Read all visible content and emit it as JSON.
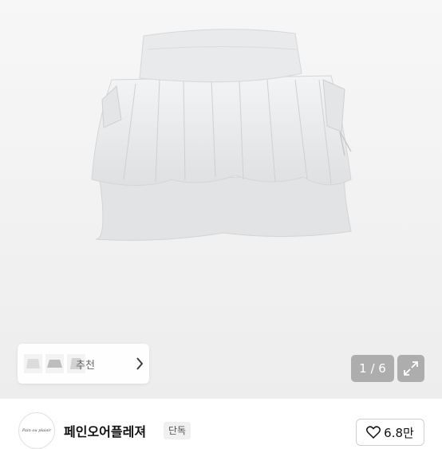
{
  "gallery": {
    "counter_text": "1 / 6",
    "similar_label": "추천"
  },
  "shop": {
    "logo_text": "Pain ou plaisir",
    "brand_name": "페인오어플레져",
    "badge": "단독"
  },
  "like": {
    "count": "6.8만"
  },
  "colors": {
    "background": "#efefef",
    "overlay": "#787878",
    "text_dark": "#111111"
  },
  "icons": {
    "expand": "expand-icon",
    "chevron": "chevron-right-icon",
    "heart": "heart-icon"
  }
}
